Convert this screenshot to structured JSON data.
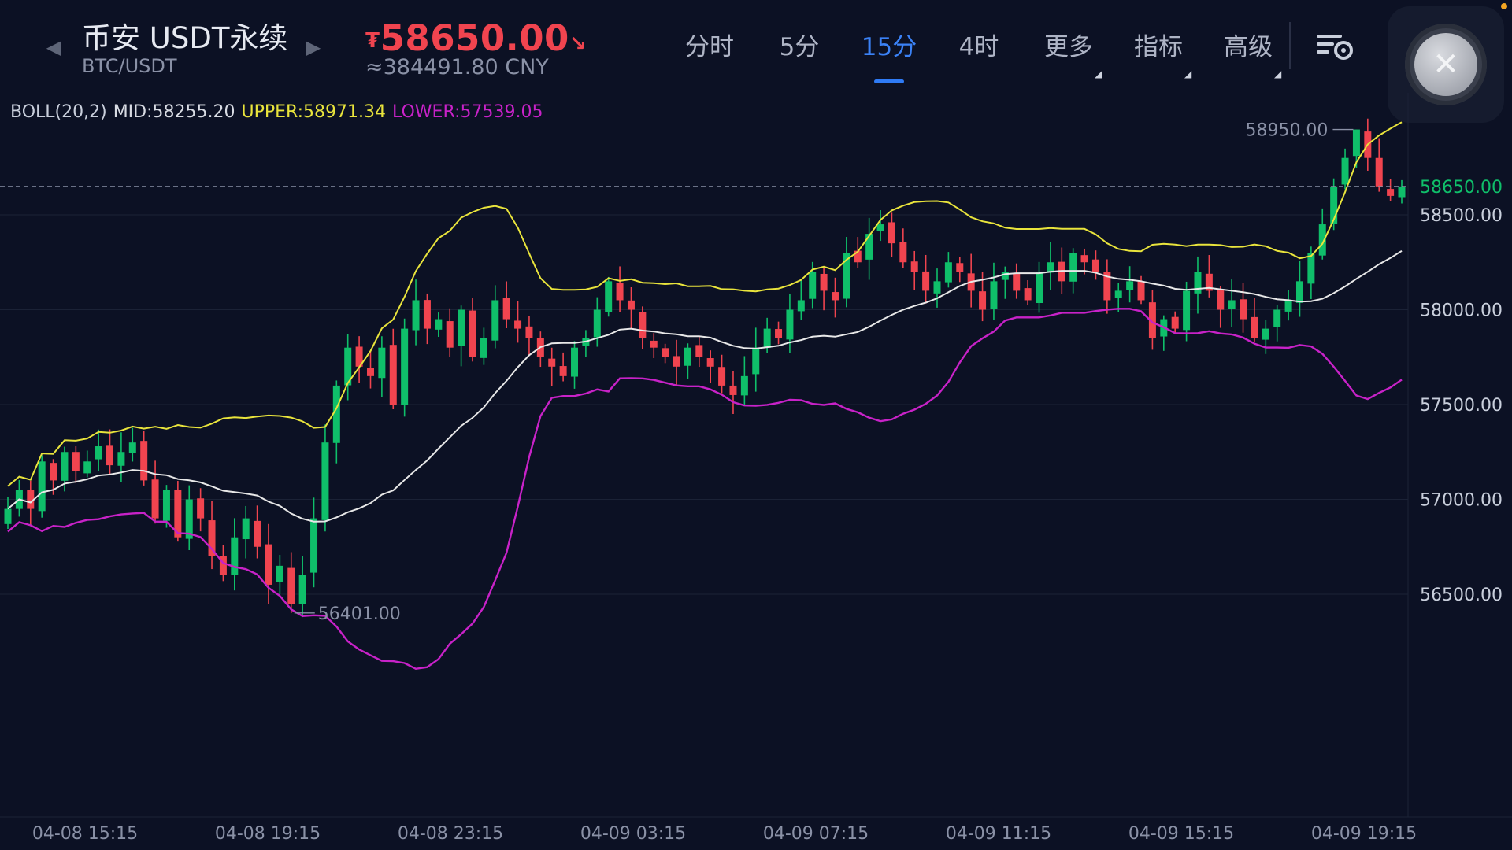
{
  "header": {
    "title": "币安 USDT永续",
    "subtitle": "BTC/USDT",
    "price": "58650.00",
    "price_currency_glyph": "₮",
    "price_trend_glyph": "↘",
    "price_cny": "≈384491.80 CNY",
    "prev_icon": "triangle-left-icon",
    "next_icon": "triangle-right-icon"
  },
  "tabs": [
    {
      "label": "分时",
      "active": false,
      "dropdown": false
    },
    {
      "label": "5分",
      "active": false,
      "dropdown": false
    },
    {
      "label": "15分",
      "active": true,
      "dropdown": false
    },
    {
      "label": "4时",
      "active": false,
      "dropdown": false
    },
    {
      "label": "更多",
      "active": false,
      "dropdown": true
    },
    {
      "label": "指标",
      "active": false,
      "dropdown": true
    },
    {
      "label": "高级",
      "active": false,
      "dropdown": true
    }
  ],
  "indicator": {
    "name": "BOLL(20,2)",
    "mid": "MID:58255.20",
    "upper": "UPPER:58971.34",
    "lower": "LOWER:57539.05"
  },
  "colors": {
    "up": "#0fbf6a",
    "down": "#f0444f",
    "mid_line": "#e8e8e8",
    "upper_line": "#e9e43c",
    "lower_line": "#c822c8",
    "accent": "#2f7bf5"
  },
  "chart_data": {
    "type": "candlestick",
    "symbol": "BTC/USDT",
    "interval": "15分",
    "y_ticks": [
      "58500.00",
      "58000.00",
      "57500.00",
      "57000.00",
      "56500.00"
    ],
    "y_range": [
      56150,
      59250
    ],
    "x_labels": [
      "04-08 15:15",
      "04-08 19:15",
      "04-08 23:15",
      "04-09 03:15",
      "04-09 07:15",
      "04-09 11:15",
      "04-09 15:15",
      "04-09 19:15"
    ],
    "current_price_label": "58650.00",
    "max_label": "58950.00",
    "min_label": "56401.00",
    "closes": [
      56950,
      57050,
      56950,
      57200,
      57100,
      57250,
      57150,
      57200,
      57280,
      57180,
      57250,
      57300,
      57100,
      56900,
      57050,
      56800,
      57000,
      56900,
      56700,
      56600,
      56800,
      56900,
      56750,
      56550,
      56650,
      56450,
      56600,
      56900,
      57300,
      57600,
      57800,
      57700,
      57650,
      57800,
      57500,
      57900,
      58050,
      57900,
      57950,
      57800,
      58000,
      57750,
      57850,
      58050,
      57950,
      57900,
      57850,
      57750,
      57700,
      57650,
      57800,
      57850,
      58000,
      58150,
      58050,
      58000,
      57850,
      57800,
      57750,
      57700,
      57800,
      57750,
      57700,
      57600,
      57550,
      57650,
      57800,
      57900,
      57850,
      58000,
      58050,
      58200,
      58100,
      58050,
      58300,
      58250,
      58400,
      58450,
      58350,
      58250,
      58200,
      58100,
      58150,
      58250,
      58200,
      58100,
      58000,
      58150,
      58200,
      58100,
      58050,
      58200,
      58250,
      58150,
      58300,
      58250,
      58200,
      58050,
      58100,
      58150,
      58050,
      57850,
      57950,
      57900,
      58100,
      58200,
      58100,
      58000,
      58050,
      57950,
      57850,
      57900,
      58000,
      58050,
      58150,
      58300,
      58450,
      58650,
      58800,
      58950,
      58800,
      58650,
      58600,
      58650
    ],
    "upper_band_last": "58971.34",
    "mid_band_last": "58255.20",
    "lower_band_last": "57539.05"
  }
}
